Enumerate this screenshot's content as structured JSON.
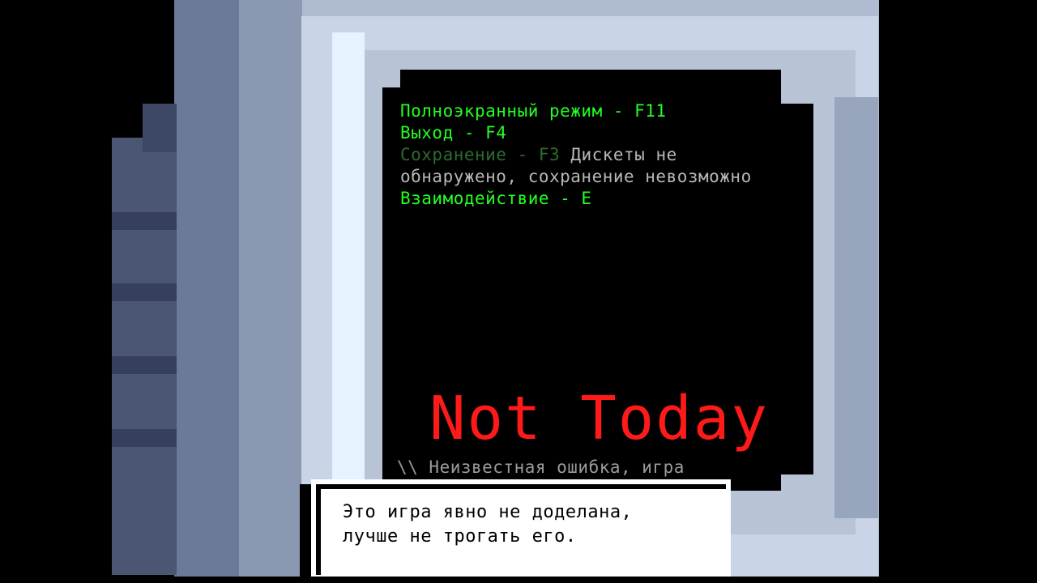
{
  "controls": {
    "fullscreen": "Полноэкранный режим - F11",
    "exit": "Выход - F4",
    "save_disabled": "Сохранение - F3",
    "save_note_1": "Дискеты не",
    "save_note_2": "обнаружено, сохранение невозможно",
    "interact": "Взаимодействие - E"
  },
  "title": "Not Today",
  "error_line": "\\\\ Неизвестная ошибка, игра",
  "dialog": {
    "line1": "Это игра явно не доделана,",
    "line2": "лучше не трогать его."
  },
  "colors": {
    "active_text": "#22ff22",
    "disabled_text": "#2e6b2e",
    "note_text": "#b7b7b7",
    "title": "#ff1a1a",
    "screen": "#000000"
  }
}
